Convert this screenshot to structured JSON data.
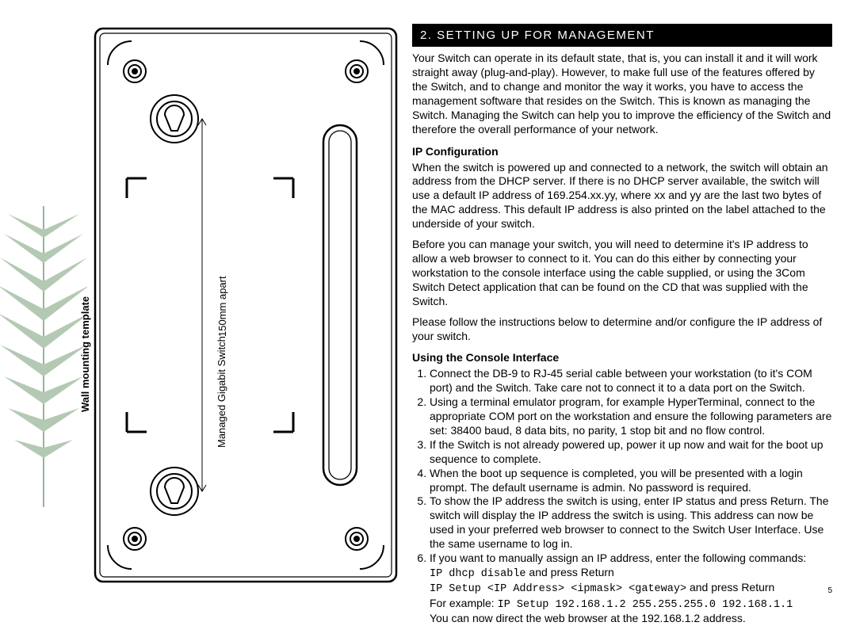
{
  "page_number": "5",
  "section_header": "2. SETTING UP FOR MANAGEMENT",
  "intro": "Your Switch can operate in its default state, that is, you can install it and it will work straight away (plug-and-play). However, to make full use of the features offered by the Switch, and to change and monitor the way it works, you have to access the management software that resides on the Switch. This is known as managing the Switch. Managing the Switch can help you to improve the efficiency of the Switch and therefore the overall performance of your network.",
  "ipconfig": {
    "heading": "IP Configuration",
    "p1": "When the switch is powered up and connected to a network, the switch will obtain an address from the DHCP server. If there is no DHCP server available, the switch will use a default IP address of 169.254.xx.yy, where xx and yy are the last two bytes of the MAC address. This default IP address is also printed on the label attached to the underside of your switch.",
    "p2": "Before you can manage your switch, you will need to determine it's IP address to allow a web browser to connect to it. You can do this either by connecting your workstation to the console interface using the cable supplied, or using the 3Com Switch Detect application that can be found on the CD that was supplied with the Switch.",
    "p3": "Please follow the instructions below to determine and/or configure the IP address of your switch."
  },
  "console": {
    "heading": "Using the Console Interface",
    "steps": [
      "Connect the DB-9 to RJ-45 serial cable between your workstation (to it's COM port) and the Switch. Take care not to connect it to a data port on the Switch.",
      "Using a terminal emulator program, for example HyperTerminal, connect to the appropriate COM port on the workstation and ensure the following parameters are set: 38400 baud, 8 data bits, no parity, 1 stop bit and no flow control.",
      "If the Switch is not already powered up, power it up now and wait for the boot up sequence to complete.",
      "When the boot up sequence is completed, you will be presented with a login prompt. The default username is admin. No password is required.",
      "To show the IP address the switch is using, enter IP status and press Return. The switch will display the IP address the switch is using. This address can now be used in your preferred web browser to connect to the Switch User Interface. Use the same username to log in."
    ],
    "step6_intro": "If you want to manually assign an IP address, enter the following commands:",
    "cmd1": "IP dhcp disable",
    "cmd1_suffix": " and press Return",
    "cmd2": "IP Setup <IP Address> <ipmask> <gateway>",
    "cmd2_suffix": " and press Return",
    "example_prefix": "For example: ",
    "example_cmd": "IP Setup 192.168.1.2 255.255.255.0 192.168.1.1",
    "final": "You can now direct the web browser at the 192.168.1.2 address."
  },
  "template": {
    "title": "Wall mounting template",
    "device": "Managed Gigabit Switch",
    "spacing": "150mm apart"
  }
}
